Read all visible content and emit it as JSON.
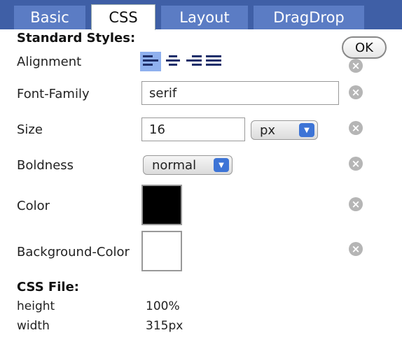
{
  "tabs": [
    {
      "label": "Basic",
      "active": false
    },
    {
      "label": "CSS",
      "active": true
    },
    {
      "label": "Layout",
      "active": false
    },
    {
      "label": "DragDrop",
      "active": false
    }
  ],
  "ok_label": "OK",
  "standard_styles": {
    "title": "Standard Styles:",
    "alignment_label": "Alignment",
    "alignment_options": [
      "align-left-icon",
      "align-center-icon",
      "align-right-icon",
      "align-justify-icon"
    ],
    "alignment_selected": "align-left-icon",
    "font_family_label": "Font-Family",
    "font_family_value": "serif",
    "size_label": "Size",
    "size_value": "16",
    "size_unit": "px",
    "boldness_label": "Boldness",
    "boldness_value": "normal",
    "color_label": "Color",
    "color_value": "#000000",
    "bg_color_label": "Background-Color",
    "bg_color_value": "#ffffff"
  },
  "css_file": {
    "title": "CSS File:",
    "rows": [
      {
        "key": "height",
        "value": "100%"
      },
      {
        "key": "width",
        "value": "315px"
      }
    ]
  },
  "colors": {
    "tab_bar": "#3f5fa6",
    "tab_inactive": "#5b7cc4",
    "select_arrow": "#3d74d6",
    "align_active": "#8fb0ee"
  }
}
